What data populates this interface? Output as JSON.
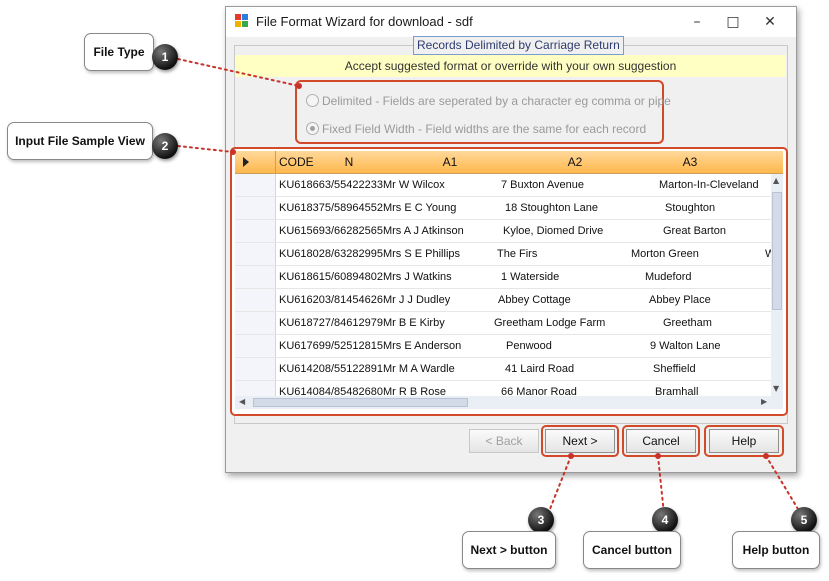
{
  "window": {
    "title": "File Format Wizard for download - sdf",
    "controls": {
      "minimize": "–",
      "maximize": "□",
      "close": "✕"
    }
  },
  "wizard": {
    "group_title": "Records Delimited by Carriage Return",
    "hint": "Accept suggested format or override with your own suggestion",
    "options": [
      {
        "label": "Delimited - Fields are seperated by a character eg comma or pipe",
        "checked": false
      },
      {
        "label": "Fixed Field Width - Field widths are the same for each record",
        "checked": true
      }
    ]
  },
  "grid": {
    "columns": [
      "CODE",
      "N",
      "A1",
      "A2",
      "A3"
    ],
    "rows": [
      {
        "code": "KU618663/55422233Mr W Wilcox",
        "a1": "7 Buxton Avenue",
        "a2": "Marton-In-Cleveland",
        "a3": ""
      },
      {
        "code": "KU618375/58964552Mrs E C Young",
        "a1": "18 Stoughton Lane",
        "a2": "Stoughton",
        "a3": ""
      },
      {
        "code": "KU615693/66282565Mrs A J Atkinson",
        "a1": "Kyloe, Diomed Drive",
        "a2": "Great Barton",
        "a3": ""
      },
      {
        "code": "KU618028/63282995Mrs S E Phillips",
        "a1": "The Firs",
        "a2": "Morton Green",
        "a3": "W"
      },
      {
        "code": "KU618615/60894802Mrs J Watkins",
        "a1": "1 Waterside",
        "a2": "Mudeford",
        "a3": ""
      },
      {
        "code": "KU616203/81454626Mr J J Dudley",
        "a1": "Abbey Cottage",
        "a2": "Abbey Place",
        "a3": ""
      },
      {
        "code": "KU618727/84612979Mr B E Kirby",
        "a1": "Greetham Lodge Farm",
        "a2": "Greetham",
        "a3": ""
      },
      {
        "code": "KU617699/52512815Mrs E Anderson",
        "a1": "Penwood",
        "a2": "9 Walton Lane",
        "a3": ""
      },
      {
        "code": "KU614208/55122891Mr M A Wardle",
        "a1": "41 Laird Road",
        "a2": "Sheffield",
        "a3": ""
      },
      {
        "code": "KU614084/85482680Mr R B Rose",
        "a1": "66 Manor Road",
        "a2": "Bramhall",
        "a3": ""
      },
      {
        "code": "",
        "a1": "",
        "a2": "",
        "a3": ""
      }
    ]
  },
  "buttons": {
    "back": "< Back",
    "next": "Next >",
    "cancel": "Cancel",
    "help": "Help"
  },
  "callouts": [
    {
      "number": "1",
      "label": "File Type"
    },
    {
      "number": "2",
      "label": "Input File Sample View"
    },
    {
      "number": "3",
      "label": "Next > button"
    },
    {
      "number": "4",
      "label": "Cancel button"
    },
    {
      "number": "5",
      "label": "Help button"
    }
  ],
  "colors": {
    "highlight": "#d24a2a",
    "header": "#ffb84d",
    "hint_bg": "#ffffc4"
  }
}
